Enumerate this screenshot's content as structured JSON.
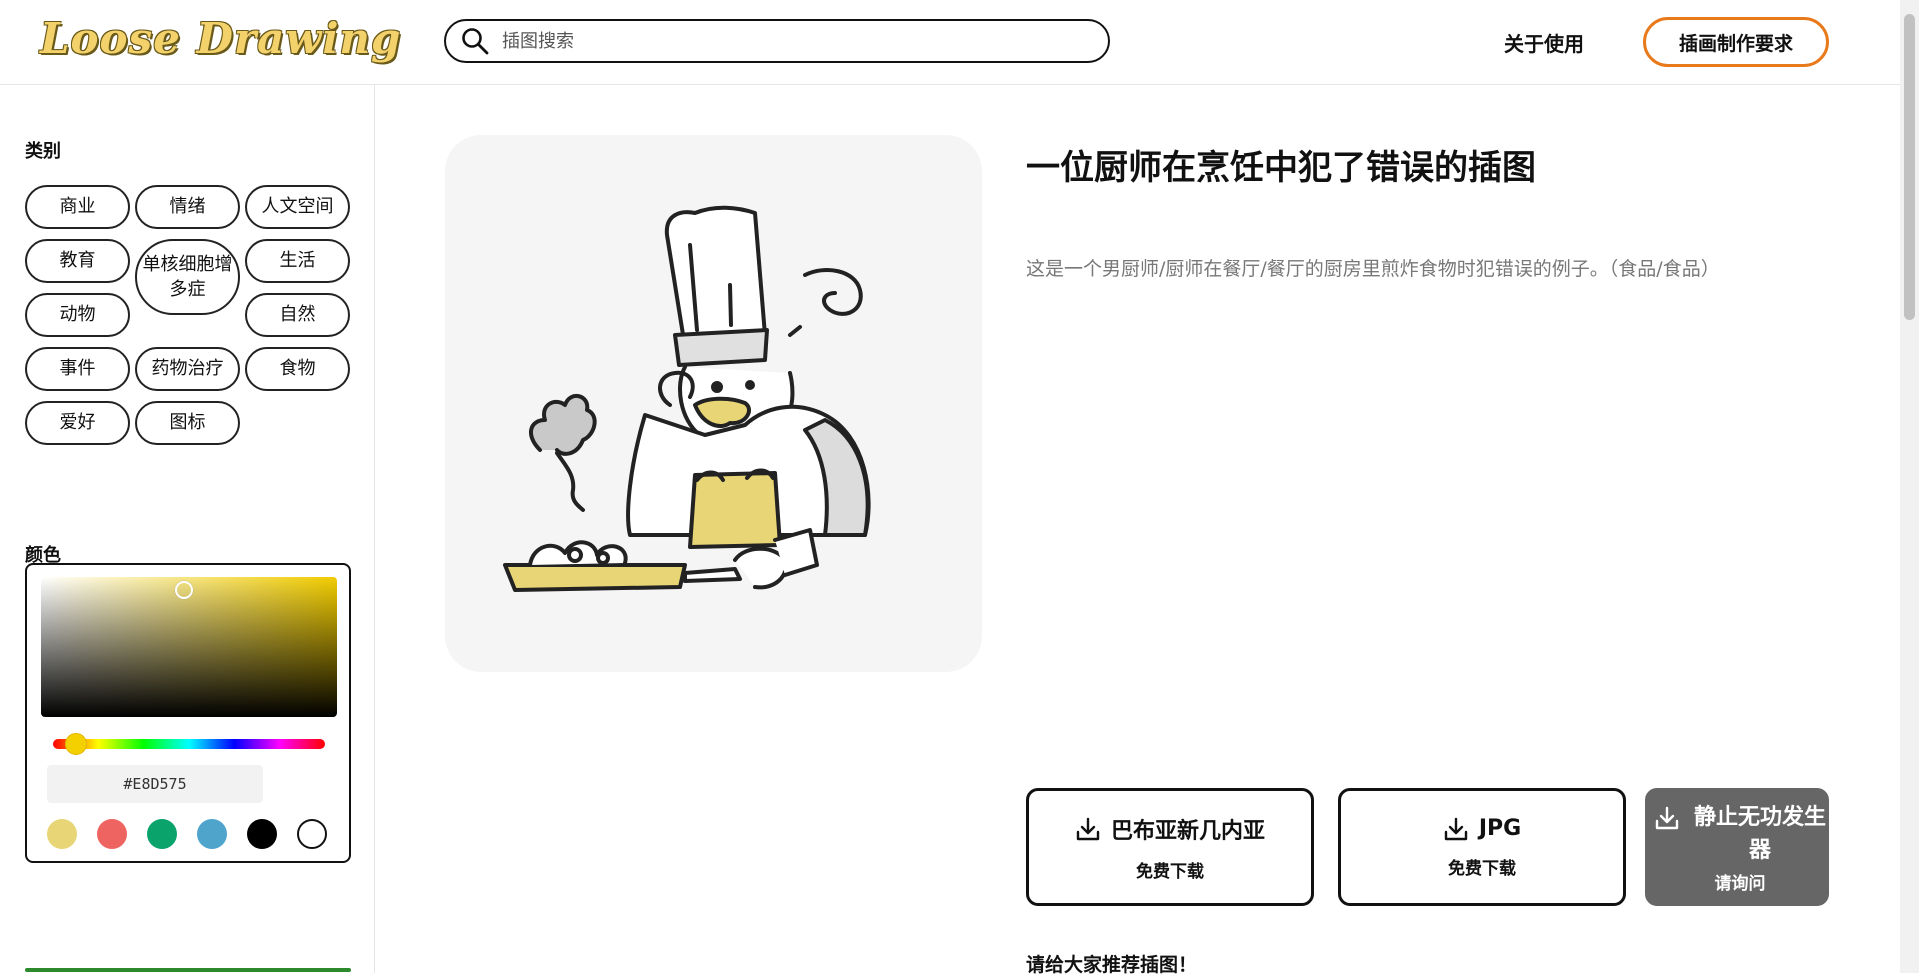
{
  "header": {
    "logo": "Loose Drawing",
    "search_placeholder": "插图搜索",
    "about_label": "关于使用",
    "request_label": "插画制作要求"
  },
  "sidebar": {
    "category_title": "类别",
    "categories": [
      "商业",
      "情绪",
      "人文空间",
      "教育",
      "单核细胞增多症",
      "生活",
      "动物",
      "自然",
      "事件",
      "药物治疗",
      "食物",
      "爱好",
      "图标"
    ],
    "color_title": "颜色",
    "hex_value": "#E8D575",
    "swatches": [
      "#e8d575",
      "#ee6461",
      "#0aa36c",
      "#4ea4cb",
      "#000000",
      "#ffffff"
    ]
  },
  "main": {
    "title": "一位厨师在烹饪中犯了错误的插图",
    "description": "这是一个男厨师/厨师在餐厅/餐厅的厨房里煎炸食物时犯错误的例子。（食品/食品）",
    "downloads": [
      {
        "label": "巴布亚新几内亚",
        "sub": "免费下载"
      },
      {
        "label": "JPG",
        "sub": "免费下载"
      },
      {
        "label": "静止无功发生器",
        "sub": "请询问"
      }
    ],
    "recommend_label": "请给大家推荐插图！"
  },
  "colors": {
    "accent_orange": "#e97a1c",
    "illustration_yellow": "#e8d575"
  }
}
